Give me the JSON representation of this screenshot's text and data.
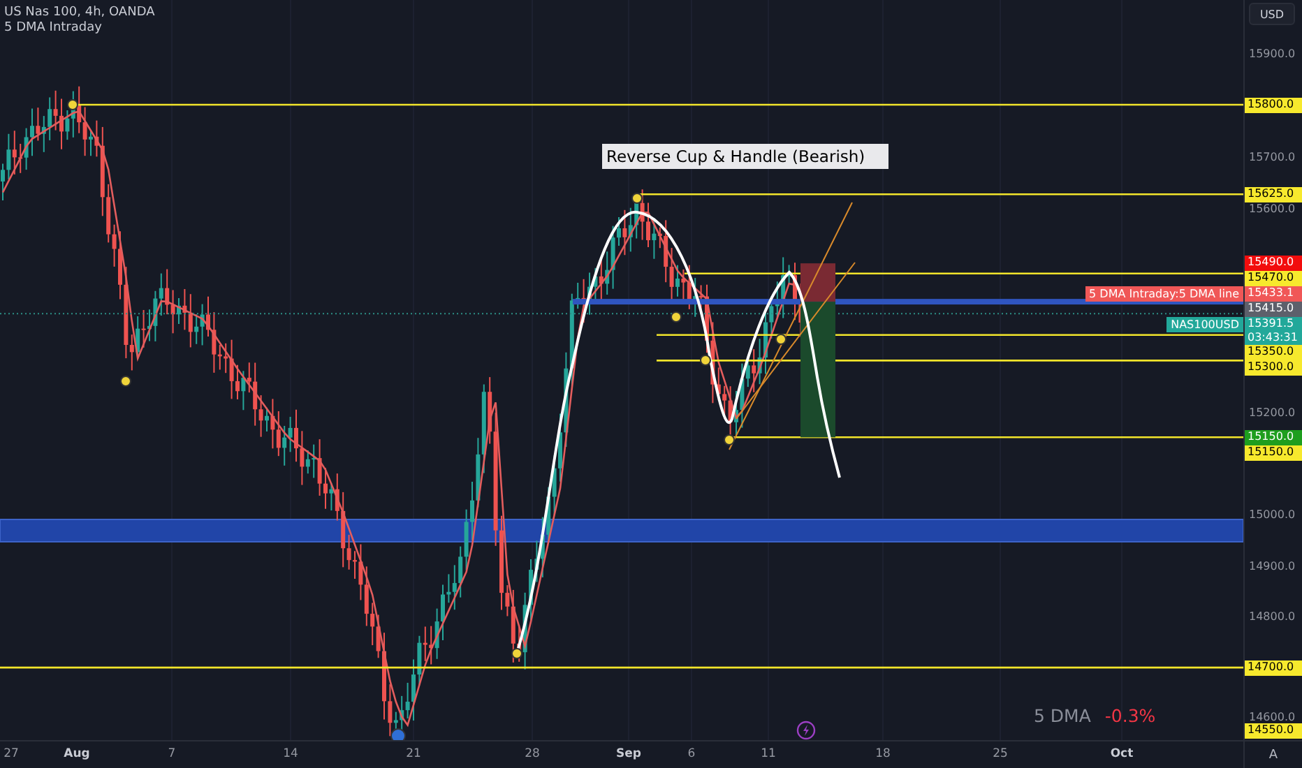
{
  "header": {
    "title": "US Nas 100, 4h, OANDA",
    "indicator": "5 DMA Intraday"
  },
  "currency_button": "USD",
  "annotation": "Reverse Cup & Handle (Bearish)",
  "price_axis": {
    "ticks": [
      "15900.0",
      "15700.0",
      "15600.0",
      "15200.0",
      "15000.0",
      "14900.0",
      "14800.0",
      "14600.0"
    ]
  },
  "price_tags": [
    {
      "label": "15800.0",
      "kind": "level"
    },
    {
      "label": "15625.0",
      "kind": "level"
    },
    {
      "label": "15490.0",
      "kind": "stop"
    },
    {
      "label": "15470.0",
      "kind": "level"
    },
    {
      "label": "15433.1",
      "kind": "indicator",
      "caption": "5 DMA Intraday:5 DMA line"
    },
    {
      "label": "15415.0",
      "kind": "line"
    },
    {
      "label": "15391.5",
      "kind": "last",
      "caption": "NAS100USD",
      "countdown": "03:43:31"
    },
    {
      "label": "15350.0",
      "kind": "level"
    },
    {
      "label": "15300.0",
      "kind": "level"
    },
    {
      "label": "15150.0",
      "kind": "target"
    },
    {
      "label": "15150.0",
      "kind": "level"
    },
    {
      "label": "14700.0",
      "kind": "level"
    },
    {
      "label": "14550.0",
      "kind": "level"
    }
  ],
  "time_axis": {
    "labels": [
      {
        "label": "27",
        "kind": "day"
      },
      {
        "label": "Aug",
        "kind": "month"
      },
      {
        "label": "7",
        "kind": "day"
      },
      {
        "label": "14",
        "kind": "day"
      },
      {
        "label": "21",
        "kind": "day"
      },
      {
        "label": "28",
        "kind": "day"
      },
      {
        "label": "Sep",
        "kind": "month"
      },
      {
        "label": "6",
        "kind": "day"
      },
      {
        "label": "11",
        "kind": "day"
      },
      {
        "label": "18",
        "kind": "day"
      },
      {
        "label": "25",
        "kind": "day"
      },
      {
        "label": "Oct",
        "kind": "month"
      }
    ]
  },
  "auto_button": "A",
  "legend": {
    "name": "5 DMA",
    "change": "-0.3%"
  }
}
